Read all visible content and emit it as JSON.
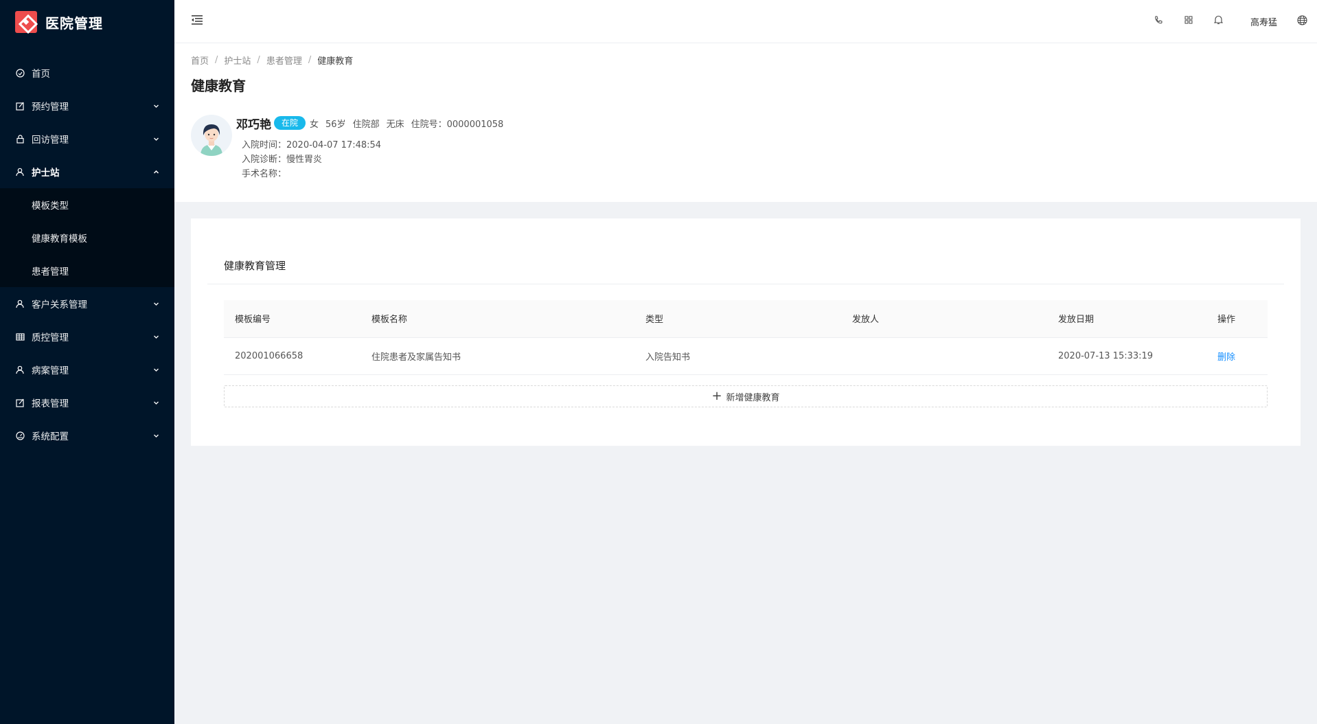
{
  "app": {
    "title": "医院管理"
  },
  "sidebar": {
    "items": [
      {
        "label": "首页",
        "icon": "dashboard-icon"
      },
      {
        "label": "预约管理",
        "icon": "form-icon"
      },
      {
        "label": "回访管理",
        "icon": "lock-icon"
      },
      {
        "label": "护士站",
        "icon": "user-icon",
        "open": true,
        "children": [
          {
            "label": "模板类型"
          },
          {
            "label": "健康教育模板"
          },
          {
            "label": "患者管理"
          }
        ]
      },
      {
        "label": "客户关系管理",
        "icon": "team-icon"
      },
      {
        "label": "质控管理",
        "icon": "table-icon"
      },
      {
        "label": "病案管理",
        "icon": "user-icon"
      },
      {
        "label": "报表管理",
        "icon": "form-icon"
      },
      {
        "label": "系统配置",
        "icon": "setting-icon"
      }
    ]
  },
  "header": {
    "username": "高寿猛"
  },
  "breadcrumb": [
    "首页",
    "护士站",
    "患者管理",
    "健康教育"
  ],
  "page": {
    "title": "健康教育"
  },
  "patient": {
    "name": "邓巧艳",
    "status": "在院",
    "gender": "女",
    "age": "56岁",
    "department": "住院部",
    "bed": "无床",
    "admission_no": "住院号：0000001058",
    "admission_time": "入院时间：2020-04-07 17:48:54",
    "diagnosis": "入院诊断：慢性胃炎",
    "surgery": "手术名称："
  },
  "card": {
    "title": "健康教育管理",
    "columns": [
      "模板编号",
      "模板名称",
      "类型",
      "发放人",
      "发放日期",
      "操作"
    ],
    "rows": [
      [
        "202001066658",
        "住院患者及家属告知书",
        "入院告知书",
        "",
        "2020-07-13 15:33:19",
        "删除"
      ]
    ],
    "add_label": "新增健康教育"
  },
  "colors": {
    "sidebar_bg": "#001529",
    "accent": "#1890ff",
    "badge": "#19b9eb",
    "logo": "#ee4d4d"
  }
}
